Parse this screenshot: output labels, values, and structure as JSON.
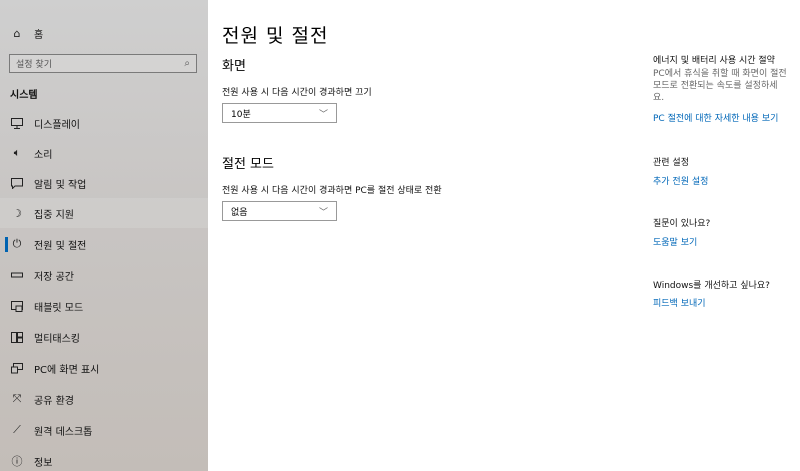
{
  "sidebar": {
    "home_label": "홈",
    "search_placeholder": "설정 찾기",
    "section_label": "시스템",
    "items": [
      {
        "label": "디스플레이",
        "icon": "monitor-icon"
      },
      {
        "label": "소리",
        "icon": "speaker-icon"
      },
      {
        "label": "알림 및 작업",
        "icon": "notification-icon"
      },
      {
        "label": "집중 지원",
        "icon": "moon-icon"
      },
      {
        "label": "전원 및 절전",
        "icon": "power-icon"
      },
      {
        "label": "저장 공간",
        "icon": "storage-icon"
      },
      {
        "label": "태블릿 모드",
        "icon": "tablet-icon"
      },
      {
        "label": "멀티태스킹",
        "icon": "multitask-icon"
      },
      {
        "label": "PC에 화면 표시",
        "icon": "project-icon"
      },
      {
        "label": "공유 환경",
        "icon": "share-icon"
      },
      {
        "label": "원격 데스크톱",
        "icon": "remote-icon"
      },
      {
        "label": "정보",
        "icon": "info-icon"
      }
    ],
    "selected_index": 4,
    "accent": "#0063b1"
  },
  "main": {
    "title": "전원 및 절전",
    "screen_section": {
      "title": "화면",
      "desc": "전원 사용 시 다음 시간이 경과하면 끄기",
      "value": "10분"
    },
    "sleep_section": {
      "title": "절전 모드",
      "desc": "전원 사용 시 다음 시간이 경과하면 PC를 절전 상태로 전환",
      "value": "없음"
    }
  },
  "right": {
    "energy_title": "에너지 및 배터리 사용 시간 절약",
    "energy_text_1": "PC에서 휴식을 취할 때 화면이 절전",
    "energy_text_2": "모드로 전환되는 속도를 설정하세",
    "energy_text_3": "요.",
    "energy_link": "PC 절전에 대한 자세한 내용 보기",
    "related_title": "관련 설정",
    "related_link": "추가 전원 설정",
    "question_title": "질문이 있나요?",
    "question_link": "도움말 보기",
    "improve_title": "Windows를 개선하고 싶나요?",
    "improve_link": "피드백 보내기",
    "link_color": "#0067b8"
  }
}
